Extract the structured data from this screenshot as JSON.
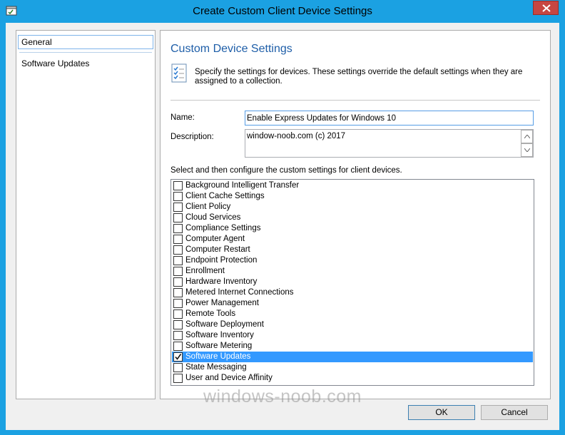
{
  "window": {
    "title": "Create Custom Client Device Settings",
    "app_icon": "settings-dialog-icon",
    "close_icon": "close-icon",
    "accent_color": "#1ba1e2"
  },
  "nav": {
    "items": [
      {
        "label": "General",
        "selected": true
      },
      {
        "label": "Software Updates",
        "selected": false
      }
    ]
  },
  "page": {
    "title": "Custom Device Settings",
    "icon": "checklist-icon",
    "description": "Specify the settings for devices. These settings override the default settings when they are assigned to a collection.",
    "name_label": "Name:",
    "name_value": "Enable Express Updates for Windows 10",
    "description_label": "Description:",
    "description_value": "window-noob.com (c) 2017",
    "instruction": "Select and then configure the custom settings for client devices."
  },
  "settings_list": [
    {
      "label": "Background Intelligent Transfer",
      "checked": false,
      "selected": false
    },
    {
      "label": "Client Cache Settings",
      "checked": false,
      "selected": false
    },
    {
      "label": "Client Policy",
      "checked": false,
      "selected": false
    },
    {
      "label": "Cloud Services",
      "checked": false,
      "selected": false
    },
    {
      "label": "Compliance Settings",
      "checked": false,
      "selected": false
    },
    {
      "label": "Computer Agent",
      "checked": false,
      "selected": false
    },
    {
      "label": "Computer Restart",
      "checked": false,
      "selected": false
    },
    {
      "label": "Endpoint Protection",
      "checked": false,
      "selected": false
    },
    {
      "label": "Enrollment",
      "checked": false,
      "selected": false
    },
    {
      "label": "Hardware Inventory",
      "checked": false,
      "selected": false
    },
    {
      "label": "Metered Internet Connections",
      "checked": false,
      "selected": false
    },
    {
      "label": "Power Management",
      "checked": false,
      "selected": false
    },
    {
      "label": "Remote Tools",
      "checked": false,
      "selected": false
    },
    {
      "label": "Software Deployment",
      "checked": false,
      "selected": false
    },
    {
      "label": "Software Inventory",
      "checked": false,
      "selected": false
    },
    {
      "label": "Software Metering",
      "checked": false,
      "selected": false
    },
    {
      "label": "Software Updates",
      "checked": true,
      "selected": true
    },
    {
      "label": "State Messaging",
      "checked": false,
      "selected": false
    },
    {
      "label": "User and Device Affinity",
      "checked": false,
      "selected": false
    }
  ],
  "buttons": {
    "ok": "OK",
    "cancel": "Cancel"
  },
  "watermark": "windows-noob.com"
}
